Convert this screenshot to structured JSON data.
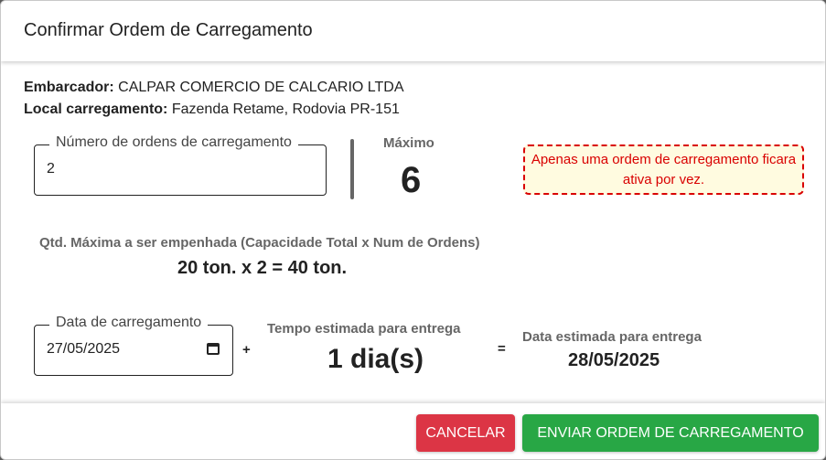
{
  "modal": {
    "title": "Confirmar Ordem de Carregamento"
  },
  "info": {
    "embarcador_label": "Embarcador:",
    "embarcador_value": "CALPAR COMERCIO DE CALCARIO LTDA",
    "local_label": "Local carregamento:",
    "local_value": "Fazenda Retame, Rodovia PR-151"
  },
  "orders": {
    "field_label": "Número de ordens de carregamento",
    "field_value": "2",
    "max_label": "Máximo",
    "max_value": "6",
    "warning": "Apenas uma ordem de carregamento ficara ativa por vez."
  },
  "quantity": {
    "label": "Qtd. Máxima a ser empenhada (Capacidade Total x Num de Ordens)",
    "value": "20 ton. x 2 = 40 ton."
  },
  "dates": {
    "field_label": "Data de carregamento",
    "field_value": "27/05/2025",
    "plus": "+",
    "tempo_label": "Tempo estimada para entrega",
    "tempo_value": "1 dia(s)",
    "equals": "=",
    "estimated_label": "Data estimada para entrega",
    "estimated_value": "28/05/2025"
  },
  "footer": {
    "cancel_label": "CANCELAR",
    "send_label": "ENVIAR ORDEM DE CARREGAMENTO"
  },
  "icons": {
    "calendar": "calendar-icon"
  },
  "colors": {
    "danger": "#dc3545",
    "success": "#28a745",
    "warning_text": "#d90000",
    "warning_bg": "#fffbe0"
  }
}
